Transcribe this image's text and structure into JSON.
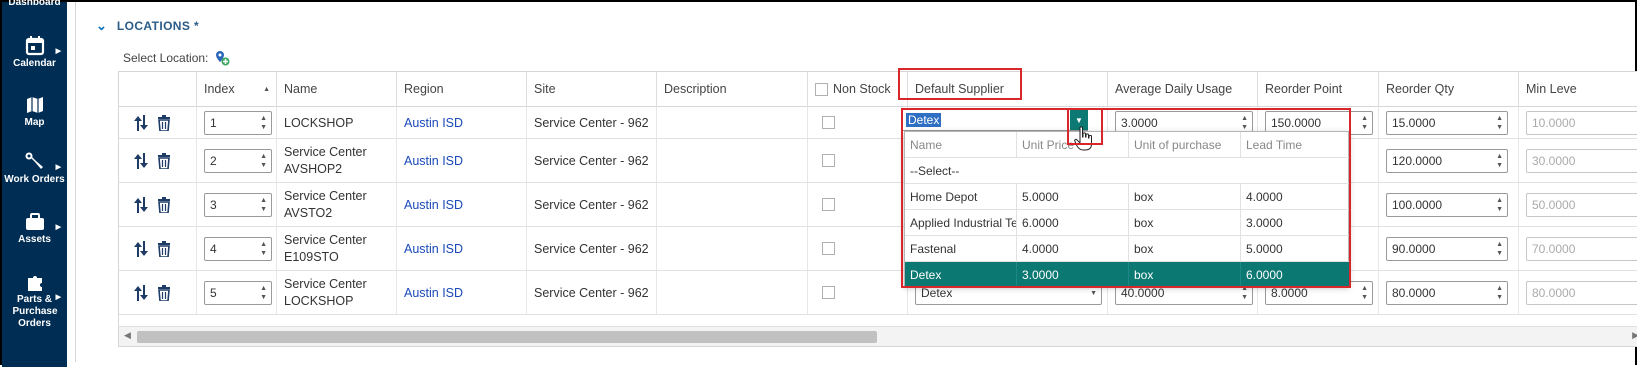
{
  "nav": {
    "top_label": "Dashboard",
    "items": [
      {
        "label": "Calendar",
        "icon": "calendar-icon"
      },
      {
        "label": "Map",
        "icon": "map-icon"
      },
      {
        "label": "Work Orders",
        "icon": "wrench-icon"
      },
      {
        "label": "Assets",
        "icon": "briefcase-icon"
      },
      {
        "label": "Parts & Purchase Orders",
        "icon": "puzzle-icon"
      }
    ]
  },
  "section": {
    "title": "LOCATIONS *",
    "select_location_label": "Select Location:"
  },
  "columns": [
    "",
    "Index",
    "Name",
    "Region",
    "Site",
    "Description",
    "Non Stock",
    "Default Supplier",
    "Average Daily Usage",
    "Reorder Point",
    "Reorder Qty",
    "Min Leve"
  ],
  "rows": [
    {
      "index": "1",
      "name": "LOCKSHOP",
      "name2": "",
      "region": "Austin ISD",
      "site": "Service Center - 962",
      "supplier": "Detex",
      "usage": "3.0000",
      "reorder_point": "150.0000",
      "reorder_qty": "15.0000",
      "min_level": "10.0000"
    },
    {
      "index": "2",
      "name": "Service Center",
      "name2": "AVSHOP2",
      "region": "Austin ISD",
      "site": "Service Center - 962",
      "supplier": "",
      "usage": "",
      "reorder_point": "",
      "reorder_qty": "120.0000",
      "min_level": "30.0000"
    },
    {
      "index": "3",
      "name": "Service Center",
      "name2": "AVSTO2",
      "region": "Austin ISD",
      "site": "Service Center - 962",
      "supplier": "",
      "usage": "",
      "reorder_point": "",
      "reorder_qty": "100.0000",
      "min_level": "50.0000"
    },
    {
      "index": "4",
      "name": "Service Center",
      "name2": "E109STO",
      "region": "Austin ISD",
      "site": "Service Center - 962",
      "supplier": "",
      "usage": "",
      "reorder_point": "",
      "reorder_qty": "90.0000",
      "min_level": "70.0000"
    },
    {
      "index": "5",
      "name": "Service Center",
      "name2": "LOCKSHOP",
      "region": "Austin ISD",
      "site": "Service Center - 962",
      "supplier": "Detex",
      "usage": "40.0000",
      "reorder_point": "8.0000",
      "reorder_qty": "80.0000",
      "min_level": "80.0000"
    }
  ],
  "dropdown": {
    "current_value": "Detex",
    "headers": [
      "Name",
      "Unit Price",
      "Unit of purchase",
      "Lead Time"
    ],
    "options": [
      {
        "name": "--Select--",
        "unit_price": "",
        "unit": "",
        "lead": ""
      },
      {
        "name": "Home Depot",
        "unit_price": "5.0000",
        "unit": "box",
        "lead": "4.0000"
      },
      {
        "name": "Applied Industrial Te",
        "unit_price": "6.0000",
        "unit": "box",
        "lead": "3.0000"
      },
      {
        "name": "Fastenal",
        "unit_price": "4.0000",
        "unit": "box",
        "lead": "5.0000"
      },
      {
        "name": "Detex",
        "unit_price": "3.0000",
        "unit": "box",
        "lead": "6.0000"
      }
    ],
    "selected_index": 4
  },
  "colors": {
    "nav_bg": "#002d54",
    "accent": "#0b7872",
    "link": "#1a49b8",
    "highlight": "#d9262b"
  }
}
